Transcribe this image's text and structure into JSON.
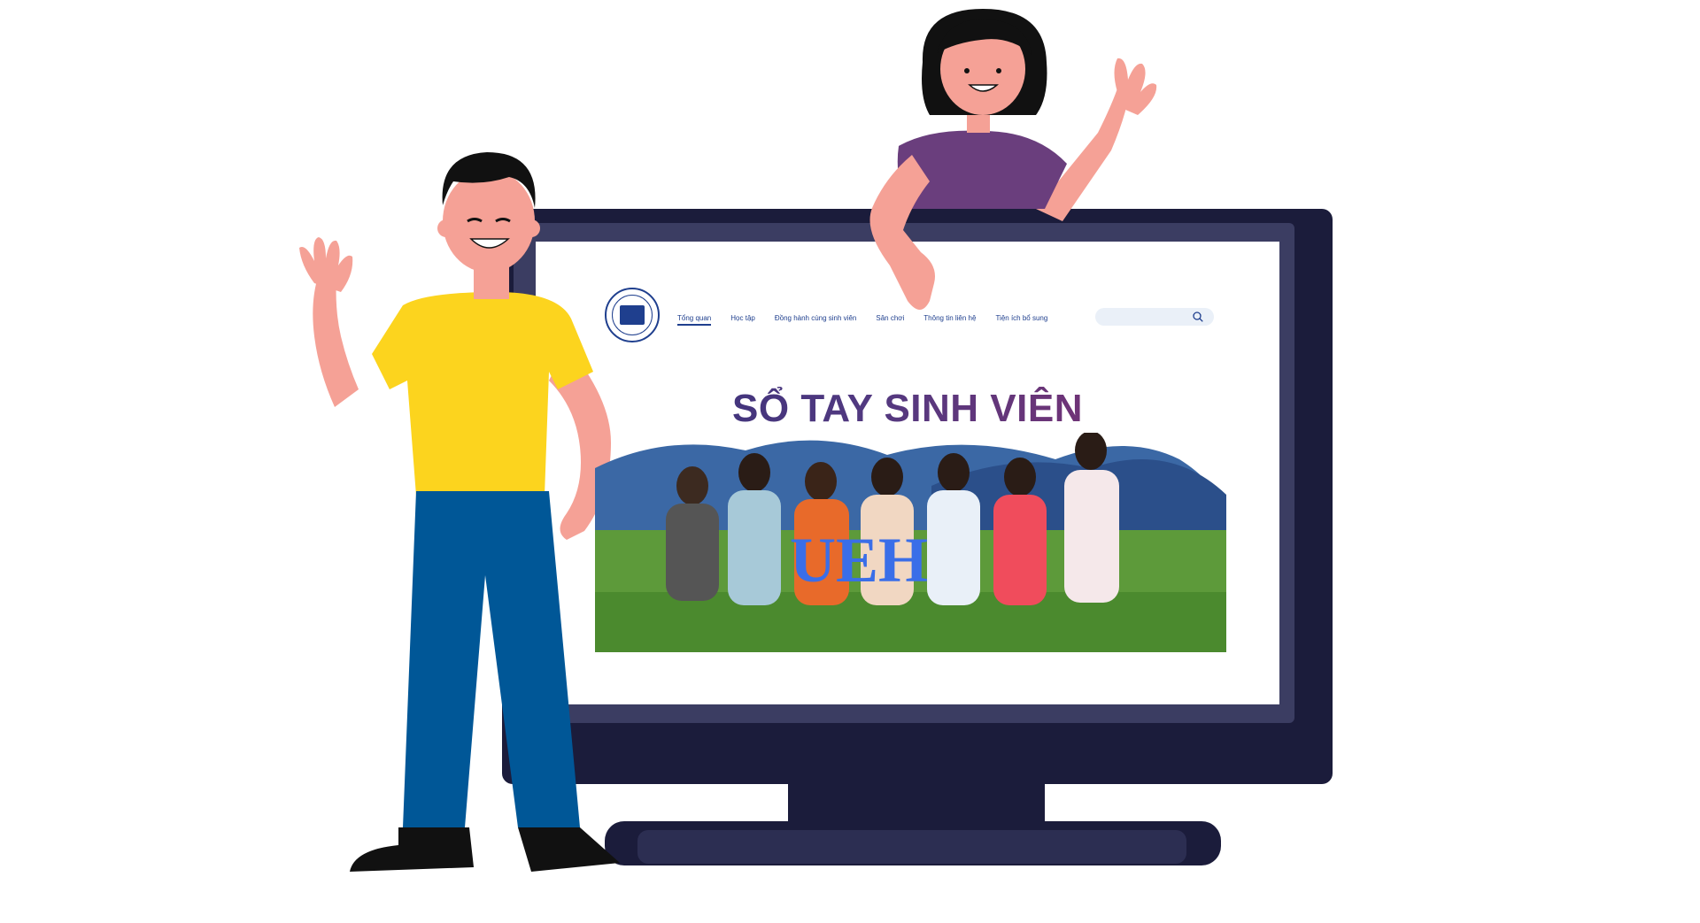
{
  "site": {
    "nav": [
      {
        "label": "Tổng quan",
        "active": true
      },
      {
        "label": "Học tập",
        "active": false
      },
      {
        "label": "Đồng hành cùng sinh viên",
        "active": false
      },
      {
        "label": "Sân chơi",
        "active": false
      },
      {
        "label": "Thông tin liên hệ",
        "active": false
      },
      {
        "label": "Tiện ích bổ sung",
        "active": false
      }
    ],
    "search_placeholder": "",
    "hero_title": "SỔ TAY SINH VIÊN",
    "photo_sign_letters": "UEH",
    "icons": {
      "search": "search-icon",
      "logo": "ueh-logo"
    }
  },
  "colors": {
    "monitor": "#1b1c3b",
    "bezel": "#3b3d62",
    "nav_text": "#1f3f8e",
    "title_start": "#2f2f78",
    "title_end": "#8a2f6e",
    "shirt_yellow": "#fcd41e",
    "pants_blue": "#005797",
    "shirt_purple": "#6a3e7d",
    "skin": "#f5a196"
  }
}
